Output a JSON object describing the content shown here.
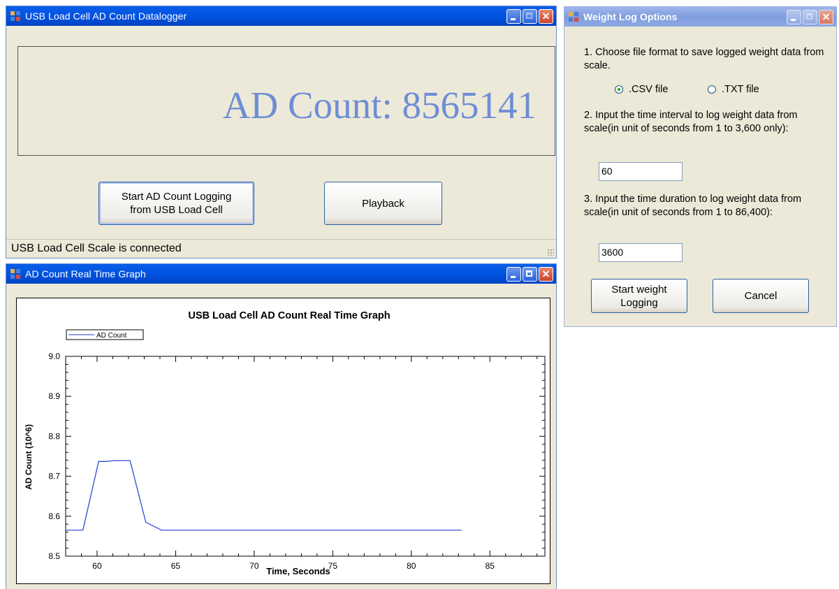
{
  "datalogger": {
    "title": "USB Load Cell AD Count Datalogger",
    "ad_display": "AD Count: 8565141",
    "start_button": "Start AD Count Logging\nfrom USB Load Cell",
    "playback_button": "Playback",
    "status": "USB Load Cell Scale is connected"
  },
  "graph_window": {
    "title": "AD Count Real Time Graph"
  },
  "options": {
    "title": "Weight Log Options",
    "step1": "1. Choose file format to save logged weight data from scale.",
    "csv_label": ".CSV file",
    "txt_label": ".TXT file",
    "format_selected": "csv",
    "step2": "2. Input the time interval to log weight data from scale(in unit of seconds from 1 to 3,600 only):",
    "interval_value": "60",
    "step3": "3. Input the time duration to log weight data from scale(in unit of seconds from 1 to 86,400):",
    "duration_value": "3600",
    "start_button": "Start weight\nLogging",
    "cancel_button": "Cancel"
  },
  "colors": {
    "accent": "#0054e3",
    "ad_text": "#6f8dd6",
    "series_line": "#1f3fd6"
  },
  "chart_data": {
    "type": "line",
    "title": "USB Load Cell AD Count Real Time Graph",
    "xlabel": "Time, Seconds",
    "ylabel": "AD Count (10^6)",
    "xlim": [
      58,
      88.5
    ],
    "ylim": [
      8.5,
      9.0
    ],
    "xticks": [
      60,
      65,
      70,
      75,
      80,
      85
    ],
    "yticks": [
      8.5,
      8.6,
      8.7,
      8.8,
      8.9,
      9.0
    ],
    "grid": false,
    "legend_position": "top-left",
    "series": [
      {
        "name": "AD Count",
        "x": [
          58.0,
          59.1,
          60.1,
          60.6,
          61.1,
          62.1,
          63.1,
          64.1,
          65.1,
          70.0,
          75.0,
          80.0,
          83.2
        ],
        "y": [
          8.565,
          8.565,
          8.737,
          8.737,
          8.739,
          8.739,
          8.585,
          8.565,
          8.565,
          8.565,
          8.565,
          8.565,
          8.565
        ]
      }
    ]
  }
}
